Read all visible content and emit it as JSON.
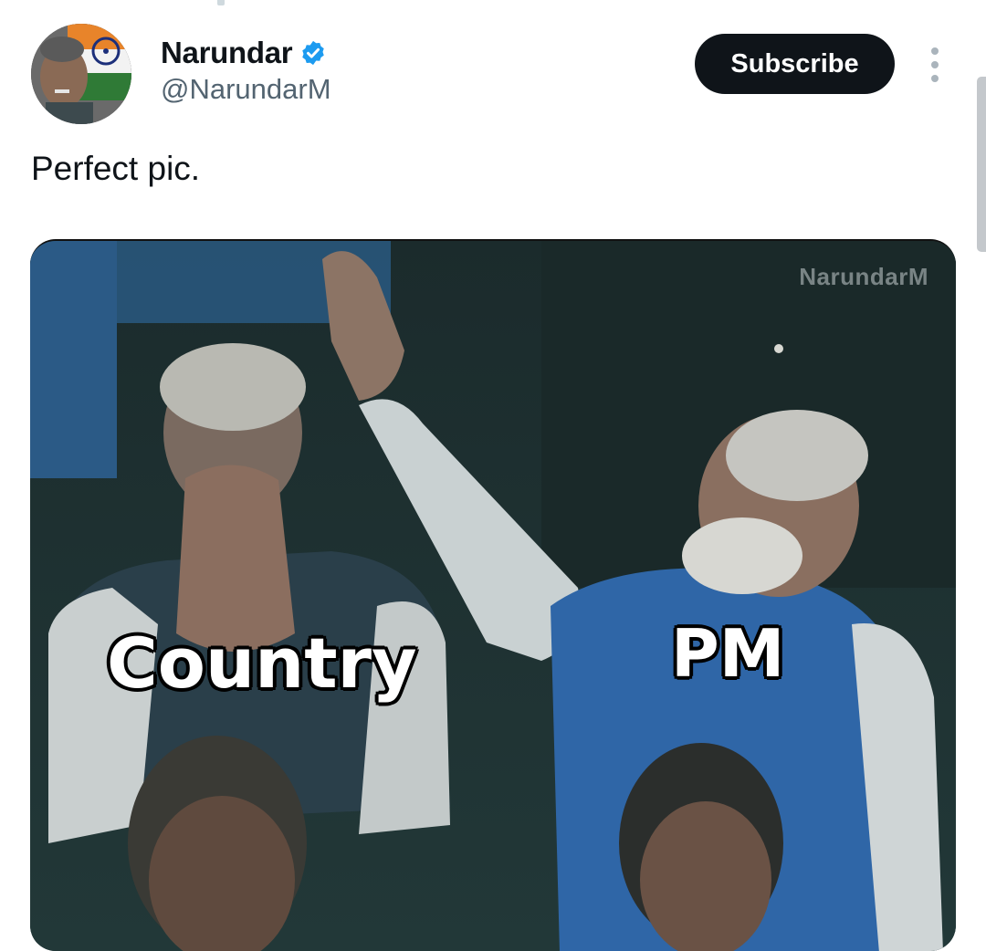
{
  "author": {
    "display_name": "Narundar",
    "handle": "@NarundarM",
    "verified_icon": "verified-badge-icon",
    "avatar_icon": "avatar-image"
  },
  "actions": {
    "subscribe_label": "Subscribe",
    "more_icon": "more-vertical-icon"
  },
  "tweet": {
    "text": "Perfect pic."
  },
  "media": {
    "watermark": "NarundarM",
    "caption_left": "Country",
    "caption_right": "PM"
  },
  "colors": {
    "text_primary": "#0f1419",
    "text_secondary": "#536471",
    "verified_blue": "#1d9bf0",
    "button_bg": "#0f1419",
    "button_text": "#ffffff"
  }
}
